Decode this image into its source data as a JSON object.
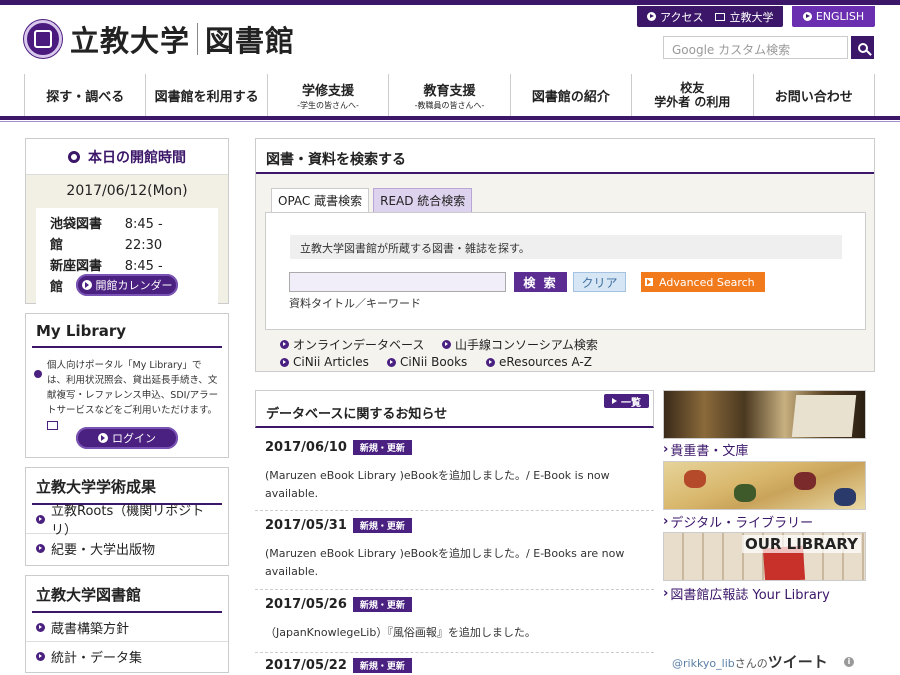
{
  "header": {
    "university": "立教大学",
    "library": "図書館",
    "util_links": [
      "アクセス",
      "立教大学"
    ],
    "english": "ENGLISH",
    "search_placeholder": "Google カスタム検索"
  },
  "nav": [
    {
      "label": "探す・調べる",
      "sub": ""
    },
    {
      "label": "図書館を利用する",
      "sub": ""
    },
    {
      "label": "学修支援",
      "sub": "-学生の皆さんへ-"
    },
    {
      "label": "教育支援",
      "sub": "-教職員の皆さんへ-"
    },
    {
      "label": "図書館の紹介",
      "sub": ""
    },
    {
      "label": "校友\n学外者 の利用",
      "sub": ""
    },
    {
      "label": "お問い合わせ",
      "sub": ""
    }
  ],
  "hours": {
    "title": "本日の開館時間",
    "date": "2017/06/12(Mon)",
    "rows": [
      {
        "name": "池袋図書館",
        "time": "8:45 - 22:30"
      },
      {
        "name": "新座図書館",
        "time": "8:45 - 21:30"
      }
    ],
    "calendar_button": "開館カレンダー"
  },
  "mylibrary": {
    "title": "My Library",
    "desc": "個人向けポータル「My Library」では、利用状況照会、貸出延長手続き、文献複写・レファレンス申込、SDI/アラートサービスなどをご利用いただけます。",
    "login": "ログイン"
  },
  "results": {
    "title": "立教大学学術成果",
    "items": [
      "立教Roots（機関リポジトリ）",
      "紀要・大学出版物"
    ]
  },
  "library_box": {
    "title": "立教大学図書館",
    "items": [
      "蔵書構築方針",
      "統計・データ集"
    ]
  },
  "search": {
    "title": "図書・資料を検索する",
    "tabs": [
      "OPAC 蔵書検索",
      "READ 統合検索"
    ],
    "note": "立教大学図書館が所蔵する図書・雑誌を探す。",
    "go": "検 索",
    "clear": "クリア",
    "advanced": "Advanced Search",
    "hint": "資料タイトル／キーワード",
    "links": [
      "オンラインデータベース",
      "山手線コンソーシアム検索",
      "CiNii Articles",
      "CiNii Books",
      "eResources A-Z"
    ]
  },
  "news": {
    "title": "データベースに関するお知らせ",
    "more": "一覧",
    "badge": "新規・更新",
    "items": [
      {
        "date": "2017/06/10",
        "text": "(Maruzen eBook Library )eBookを追加しました。/ E-Book is now available."
      },
      {
        "date": "2017/05/31",
        "text": "(Maruzen eBook Library )eBookを追加しました。/ E-Books are now available."
      },
      {
        "date": "2017/05/26",
        "text": "（JapanKnowlegeLib）『風俗画報』を追加しました。"
      },
      {
        "date": "2017/05/22",
        "text": ""
      }
    ]
  },
  "banners": [
    {
      "label": "貴重書・文庫"
    },
    {
      "label": "デジタル・ライブラリー"
    },
    {
      "label": "図書館広報誌 Your Library",
      "image_text": "OUR LIBRARY"
    }
  ],
  "tweet": {
    "handle": "@rikkyo_lib",
    "suffix": "さんの",
    "label": "ツイート"
  }
}
